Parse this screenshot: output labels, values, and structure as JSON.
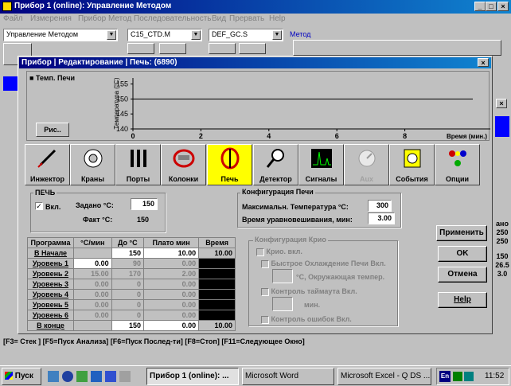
{
  "main_window": {
    "title": "Прибор 1 (online): Управление Методом",
    "menu": [
      "Файл",
      "Измерения",
      "Прибор",
      "Метод",
      "Последовательность",
      "Вид",
      "Прервать",
      "Help"
    ],
    "combos": [
      "Управление Методом",
      "C15_CTD.M",
      "DEF_GC.S"
    ],
    "method_label": "Метод"
  },
  "dialog": {
    "title": "Прибор | Редактирование | Печь: (6890)"
  },
  "graph": {
    "legend": "Темп. Печи",
    "ylabel": "Температура (°С)",
    "yticks": [
      "155",
      "150",
      "145",
      "140"
    ],
    "xticks": [
      "0",
      "2",
      "4",
      "6",
      "8"
    ],
    "xlabel": "Время (мин.)",
    "button": "Рис.."
  },
  "chart_data": {
    "type": "line",
    "series": [
      {
        "name": "Темп. Печи",
        "x": [
          0,
          10
        ],
        "values": [
          150,
          150
        ]
      }
    ],
    "xlim": [
      0,
      10
    ],
    "ylim": [
      140,
      157
    ],
    "xlabel": "Время (мин.)",
    "ylabel": "Температура (°С)"
  },
  "toolbar": [
    {
      "label": "Инжектор",
      "icon": "syringe-icon"
    },
    {
      "label": "Краны",
      "icon": "valve-icon"
    },
    {
      "label": "Порты",
      "icon": "ports-icon"
    },
    {
      "label": "Колонки",
      "icon": "column-icon"
    },
    {
      "label": "Печь",
      "icon": "oven-icon"
    },
    {
      "label": "Детектор",
      "icon": "detector-icon"
    },
    {
      "label": "Сигналы",
      "icon": "signal-icon"
    },
    {
      "label": "Aux",
      "icon": "aux-icon"
    },
    {
      "label": "События",
      "icon": "events-icon"
    },
    {
      "label": "Опции",
      "icon": "options-icon"
    }
  ],
  "oven": {
    "group": "ПЕЧЬ",
    "on_label": "Вкл.",
    "setpoint_label": "Задано °С:",
    "setpoint": "150",
    "actual_label": "Факт °С:",
    "actual": "150"
  },
  "config": {
    "group": "Конфигурация Печи",
    "max_label": "Максимальн. Температура °С:",
    "max": "300",
    "equil_label": "Время уравновешивания, мин:",
    "equil": "3.00"
  },
  "cryo": {
    "group": "Конфигурация Крио",
    "on": "Крио. вкл.",
    "fast": "Быстрое Охлаждение Печи Вкл.",
    "ambient": "°С, Окружающая темпер.",
    "timeout": "Контроль таймаута Вкл.",
    "min": "мин.",
    "fault": "Контроль ошибок Вкл."
  },
  "program": {
    "headers": [
      "Программа",
      "°С/мин",
      "До °С",
      "Плато мин",
      "Время"
    ],
    "rows": [
      [
        "В Начале",
        "",
        "150",
        "10.00",
        "10.00"
      ],
      [
        "Уровень 1",
        "0.00",
        "90",
        "0.00",
        ""
      ],
      [
        "Уровень 2",
        "15.00",
        "170",
        "2.00",
        ""
      ],
      [
        "Уровень 3",
        "0.00",
        "0",
        "0.00",
        ""
      ],
      [
        "Уровень 4",
        "0.00",
        "0",
        "0.00",
        ""
      ],
      [
        "Уровень 5",
        "0.00",
        "0",
        "0.00",
        ""
      ],
      [
        "Уровень 6",
        "0.00",
        "0",
        "0.00",
        ""
      ],
      [
        "В конце",
        "",
        "150",
        "0.00",
        "10.00"
      ]
    ]
  },
  "buttons": {
    "apply": "Применить",
    "ok": "OK",
    "cancel": "Отмена",
    "help": "Help"
  },
  "right_values": [
    "ано",
    "250",
    "250",
    "150",
    "26.5",
    "3.0"
  ],
  "status_line": "[F3= Стек ]  [F5=Пуск Анализа]  [F6=Пуск Послед-ти]  [F8=Стоп]  [F11=Следующее Окно]",
  "taskbar": {
    "start": "Пуск",
    "tasks": [
      "Прибор 1 (online): ...",
      "Microsoft Word",
      "Microsoft Excel - Q DS ..."
    ],
    "lang": "En",
    "time": "11:52"
  }
}
